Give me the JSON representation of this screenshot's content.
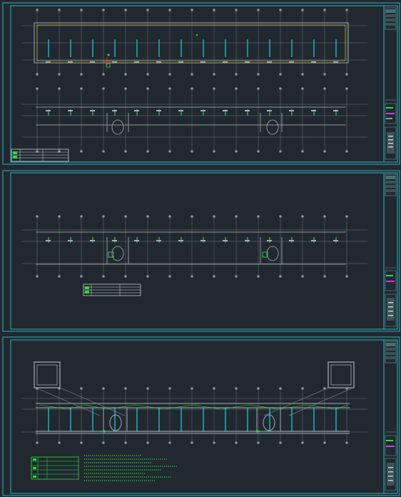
{
  "sheets": [
    {
      "id": "sheet-1",
      "title_block": "",
      "legend_rows": 3
    },
    {
      "id": "sheet-2",
      "title_block": "",
      "legend_rows": 3
    },
    {
      "id": "sheet-3",
      "title_block": "",
      "legend_rows": 5
    }
  ],
  "colors": {
    "background": "#212830",
    "frame": "#2fb3b8",
    "grid_line": "#6f7780",
    "wall": "#8d949b",
    "accent_cyan": "#22e0f0",
    "accent_green": "#29e03a",
    "accent_yellow": "#c8c23a",
    "accent_red": "#e0303a",
    "accent_magenta": "#d23ad2",
    "legend": "#ffffff"
  },
  "icons": {
    "title_block": "title-block-panel",
    "legend_table": "legend-table",
    "axis_bubble": "axis-bubble-circle",
    "stair": "stair-symbol"
  }
}
